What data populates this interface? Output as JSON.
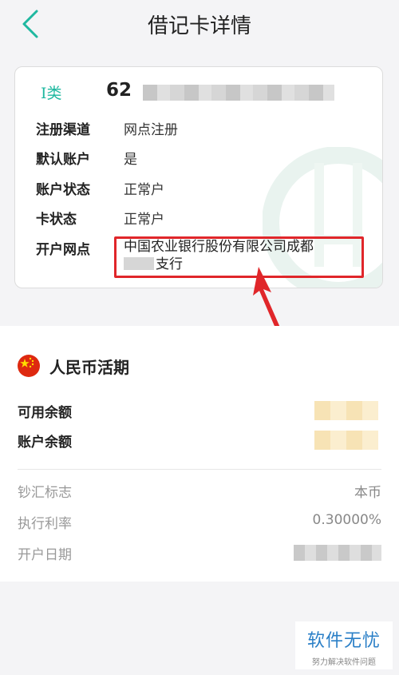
{
  "header": {
    "title": "借记卡详情"
  },
  "card": {
    "type_label": "I类",
    "number_prefix": "62",
    "rows": [
      {
        "label": "注册渠道",
        "value": "网点注册"
      },
      {
        "label": "默认账户",
        "value": "是"
      },
      {
        "label": "账户状态",
        "value": "正常户"
      },
      {
        "label": "卡状态",
        "value": "正常户"
      }
    ],
    "branch": {
      "label": "开户网点",
      "value_line1": "中国农业银行股份有限公司成都",
      "value_line2_suffix": "支行"
    }
  },
  "account": {
    "currency_title": "人民币活期",
    "balances": [
      {
        "label": "可用余额"
      },
      {
        "label": "账户余额"
      }
    ],
    "details": [
      {
        "label": "钞汇标志",
        "value": "本币"
      },
      {
        "label": "执行利率",
        "value": "0.30000%"
      },
      {
        "label": "开户日期"
      }
    ]
  },
  "watermark": {
    "main": "软件无忧",
    "sub": "努力解决软件问题"
  },
  "colors": {
    "accent": "#1fb8a0",
    "highlight": "#e0262a",
    "brand": "#2a7fc7",
    "flag": "#de2910"
  },
  "icons": {
    "back": "chevron-left-icon",
    "flag": "china-flag-icon"
  }
}
